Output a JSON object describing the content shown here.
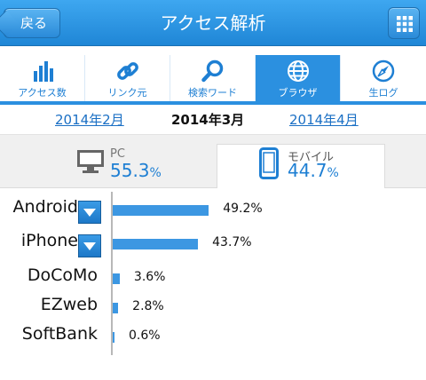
{
  "header": {
    "back_label": "戻る",
    "title": "アクセス解析",
    "menu_icon": "grid-icon"
  },
  "tabs": [
    {
      "label": "アクセス数",
      "icon": "bar-chart-icon",
      "active": false
    },
    {
      "label": "リンク元",
      "icon": "link-icon",
      "active": false
    },
    {
      "label": "検索ワード",
      "icon": "search-icon",
      "active": false
    },
    {
      "label": "ブラウザ",
      "icon": "globe-icon",
      "active": true
    },
    {
      "label": "生ログ",
      "icon": "compass-icon",
      "active": false
    }
  ],
  "months": {
    "prev": "2014年2月",
    "current": "2014年3月",
    "next": "2014年4月"
  },
  "devices": {
    "pc": {
      "label": "PC",
      "value": "55.3",
      "unit": "%"
    },
    "mobile": {
      "label": "モバイル",
      "value": "44.7",
      "unit": "%"
    }
  },
  "colors": {
    "accent": "#2b90e0",
    "bar": "#3c97e2",
    "link": "#1a6fc4"
  },
  "chart_data": {
    "type": "bar",
    "categories": [
      "Android",
      "iPhone",
      "DoCoMo",
      "EZweb",
      "SoftBank"
    ],
    "values": [
      49.2,
      43.7,
      3.6,
      2.8,
      0.6
    ],
    "labels": [
      "49.2%",
      "43.7%",
      "3.6%",
      "2.8%",
      "0.6%"
    ],
    "expandable": [
      true,
      true,
      false,
      false,
      false
    ],
    "orientation": "horizontal",
    "xlim": [
      0,
      100
    ],
    "grid": false,
    "title": "",
    "xlabel": "",
    "ylabel": ""
  }
}
